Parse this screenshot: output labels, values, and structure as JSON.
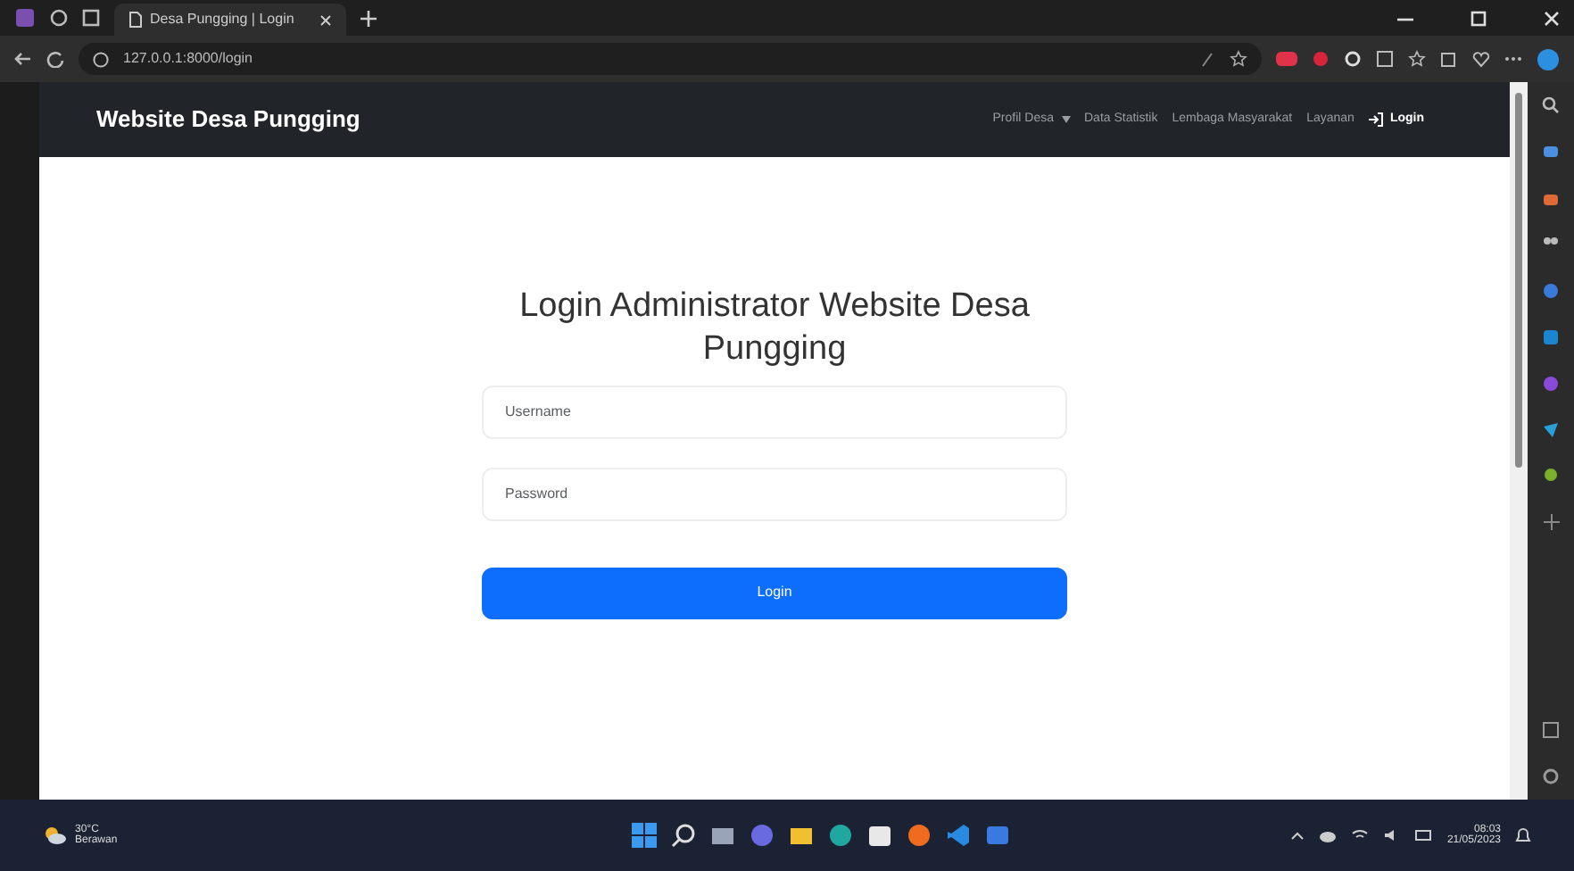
{
  "browser": {
    "tab_title": "Desa Pungging | Login",
    "address": "127.0.0.1:8000/login"
  },
  "navbar": {
    "brand": "Website Desa Pungging",
    "items": [
      {
        "label": "Profil Desa",
        "kind": "dropdown"
      },
      {
        "label": "Data Statistik",
        "kind": "link"
      },
      {
        "label": "Lembaga Masyarakat",
        "kind": "link"
      },
      {
        "label": "Layanan",
        "kind": "link"
      },
      {
        "label": "Login",
        "kind": "icon-link"
      }
    ]
  },
  "login": {
    "title": "Login Administrator Website Desa Pungging",
    "username": {
      "placeholder": "Username"
    },
    "password": {
      "placeholder": "Password"
    },
    "button": "Login"
  },
  "taskbar": {
    "temperature": "30°C",
    "weather": "Berawan",
    "time": "08:03",
    "date": "21/05/2023"
  }
}
